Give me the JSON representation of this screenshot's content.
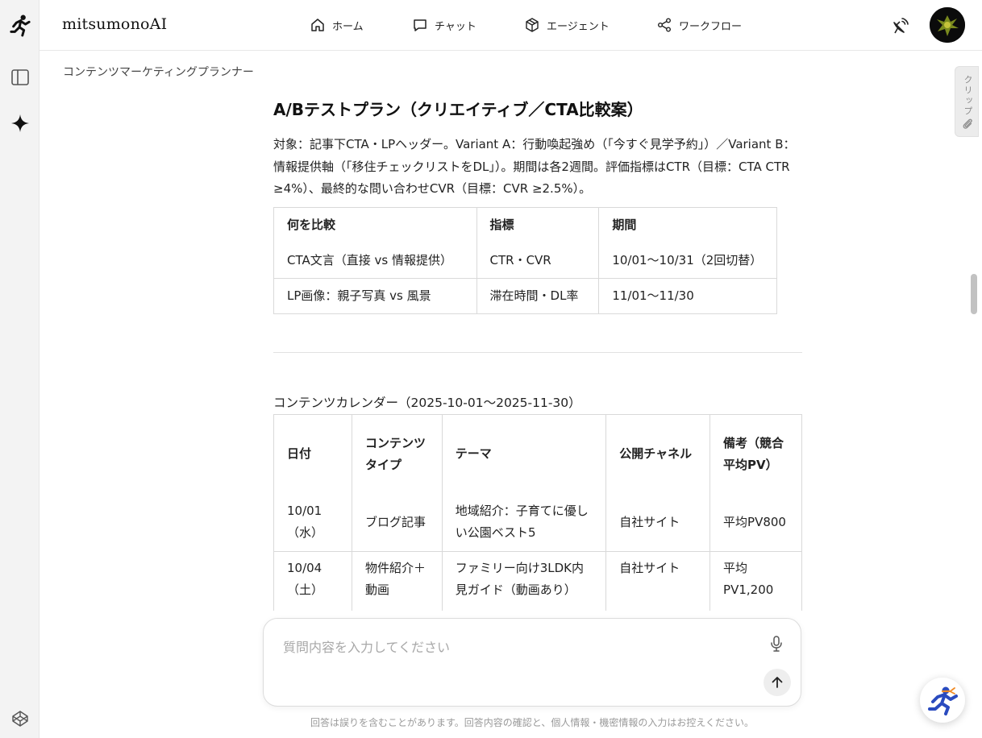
{
  "app": {
    "brand": "mitsumonoAI"
  },
  "nav": [
    {
      "label": "ホーム",
      "icon": "home-icon"
    },
    {
      "label": "チャット",
      "icon": "chat-icon"
    },
    {
      "label": "エージェント",
      "icon": "cube-icon"
    },
    {
      "label": "ワークフロー",
      "icon": "share-nodes-icon"
    }
  ],
  "page": {
    "title": "コンテンツマーケティングプランナー"
  },
  "clip": {
    "label": "クリップ"
  },
  "section": {
    "heading": "A/Bテストプラン（クリエイティブ／CTA比較案）",
    "paragraph": "対象：記事下CTA・LPヘッダー。Variant A：行動喚起強め（「今すぐ見学予約」）／Variant B：情報提供軸（「移住チェックリストをDL」）。期間は各2週間。評価指標はCTR（目標：CTA CTR ≥4%）、最終的な問い合わせCVR（目標：CVR ≥2.5%）。"
  },
  "ab_table": {
    "headers": [
      "何を比較",
      "指標",
      "期間"
    ],
    "rows": [
      [
        "CTA文言（直接 vs 情報提供）",
        "CTR・CVR",
        "10/01〜10/31（2回切替）"
      ],
      [
        "LP画像：親子写真 vs 風景",
        "滞在時間・DL率",
        "11/01〜11/30"
      ]
    ]
  },
  "calendar": {
    "title": "コンテンツカレンダー（2025-10-01〜2025-11-30）",
    "headers": [
      "日付",
      "コンテンツタイプ",
      "テーマ",
      "公開チャネル",
      "備考（競合平均PV）"
    ],
    "rows": [
      [
        "10/01（水）",
        "ブログ記事",
        "地域紹介：子育てに優しい公園ベスト5",
        "自社サイト",
        "平均PV800"
      ],
      [
        "10/04（土）",
        "物件紹介＋動画",
        "ファミリー向け3LDK内見ガイド（動画あり）",
        "自社サイト",
        "平均PV1,200"
      ]
    ]
  },
  "input": {
    "placeholder": "質問内容を入力してください"
  },
  "footer": {
    "disclaimer": "回答は誤りを含むことがあります。回答内容の確認と、個人情報・機密情報の入力はお控えください。"
  },
  "colors": {
    "rail_bg": "#f3f3f3",
    "border": "#d9d9d9",
    "accent_blue": "#2a4bbf",
    "accent_orange": "#f08a24"
  }
}
